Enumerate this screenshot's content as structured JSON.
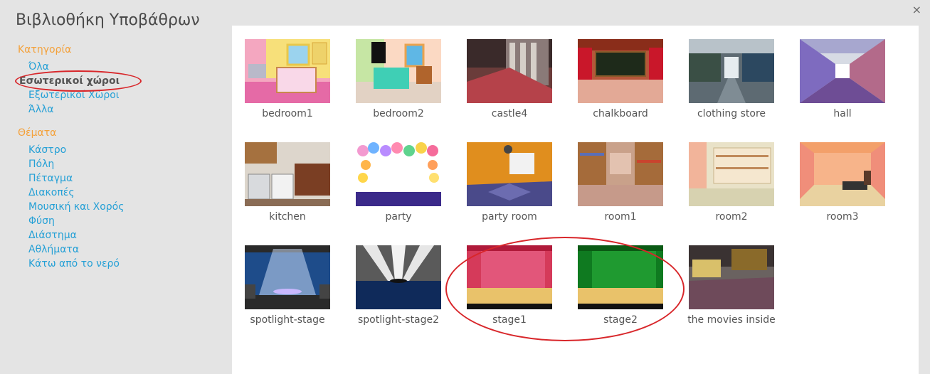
{
  "dialog": {
    "title": "Βιβλιοθήκη Υποβάθρων",
    "close_icon": "close-icon",
    "close_glyph": "×"
  },
  "sidebar": {
    "category_title": "Κατηγορία",
    "categories": [
      {
        "label": "Όλα",
        "selected": false
      },
      {
        "label": "Εσωτερικοί χώροι",
        "selected": true
      },
      {
        "label": "Εξωτερικοί Χώροι",
        "selected": false
      },
      {
        "label": "Άλλα",
        "selected": false
      }
    ],
    "themes_title": "Θέματα",
    "themes": [
      "Κάστρο",
      "Πόλη",
      "Πέταγμα",
      "Διακοπές",
      "Μουσική και Χορός",
      "Φύση",
      "Διάστημα",
      "Αθλήματα",
      "Κάτω από το νερό"
    ]
  },
  "backdrops": [
    {
      "label": "bedroom1"
    },
    {
      "label": "bedroom2"
    },
    {
      "label": "castle4"
    },
    {
      "label": "chalkboard"
    },
    {
      "label": "clothing store"
    },
    {
      "label": "hall"
    },
    {
      "label": "kitchen"
    },
    {
      "label": "party"
    },
    {
      "label": "party room"
    },
    {
      "label": "room1"
    },
    {
      "label": "room2"
    },
    {
      "label": "room3"
    },
    {
      "label": "spotlight-stage"
    },
    {
      "label": "spotlight-stage2"
    },
    {
      "label": "stage1"
    },
    {
      "label": "stage2"
    },
    {
      "label": "the movies inside"
    }
  ],
  "annotation_color": "#d8262a"
}
